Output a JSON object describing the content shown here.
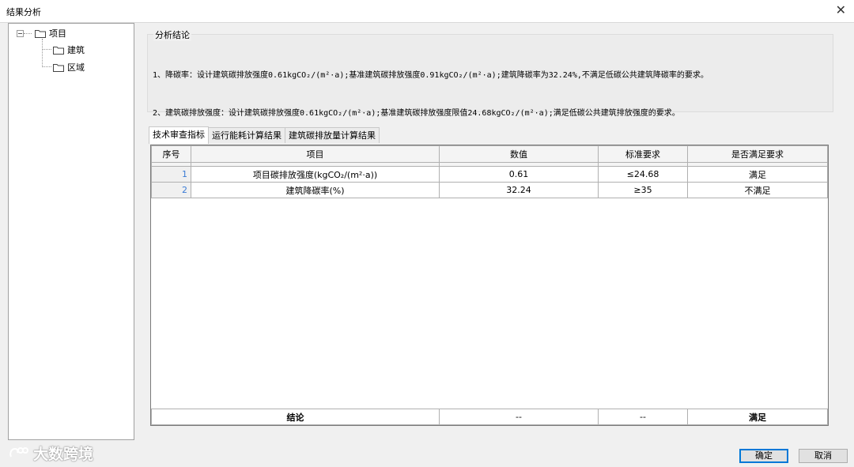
{
  "window": {
    "title": "结果分析",
    "close_glyph": "✕"
  },
  "tree": {
    "root": {
      "label": "项目",
      "icon": "folder-icon"
    },
    "children": [
      {
        "label": "建筑",
        "icon": "folder-icon"
      },
      {
        "label": "区域",
        "icon": "folder-icon"
      }
    ]
  },
  "conclusion": {
    "group_label": "分析结论",
    "lines": [
      "1、降碳率：设计建筑碳排放强度0.61kgCO₂/(m²·a);基准建筑碳排放强度0.91kgCO₂/(m²·a);建筑降碳率为32.24%,不满足低碳公共建筑降碳率的要求。",
      "2、建筑碳排放强度：设计建筑碳排放强度0.61kgCO₂/(m²·a);基准建筑碳排放强度限值24.68kgCO₂/(m²·a);满足低碳公共建筑排放强度的要求。"
    ]
  },
  "tabs": [
    {
      "label": "技术审查指标",
      "active": true
    },
    {
      "label": "运行能耗计算结果",
      "active": false
    },
    {
      "label": "建筑碳排放量计算结果",
      "active": false
    }
  ],
  "table": {
    "headers": [
      "序号",
      "项目",
      "数值",
      "标准要求",
      "是否满足要求"
    ],
    "rows": [
      [
        "1",
        "项目碳排放强度(kgCO₂/(m²·a))",
        "0.61",
        "≤24.68",
        "满足"
      ],
      [
        "2",
        "建筑降碳率(%)",
        "32.24",
        "≥35",
        "不满足"
      ]
    ],
    "summary": [
      "结论",
      "--",
      "--",
      "满足"
    ]
  },
  "buttons": {
    "ok": "确定",
    "cancel": "取消"
  },
  "watermark": {
    "text": "大数跨境"
  },
  "colors": {
    "accent": "#0078d7",
    "index_blue": "#3a7bd5"
  }
}
